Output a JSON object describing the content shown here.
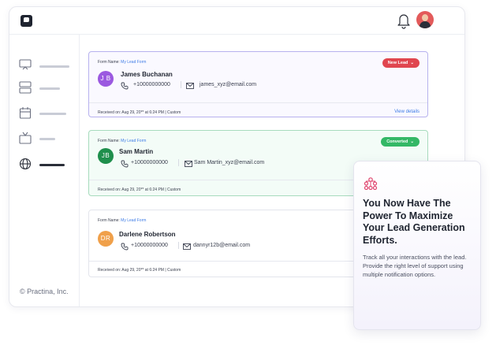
{
  "sidebar": {
    "copyright": "© Practina, Inc."
  },
  "leads": [
    {
      "form_name_label": "Form Name:",
      "form_name": "My Lead Form",
      "status": "New Lead",
      "status_color": "#e0464f",
      "initials": "J B",
      "avatar_color": "#9b59e0",
      "name": "James Buchanan",
      "phone": "+10000000000",
      "email": "james_xyz@email.com",
      "received": "Received on: Aug 29, 20** at 6:24 PM | Custom",
      "view_details": "View details"
    },
    {
      "form_name_label": "Form Name:",
      "form_name": "My Lead Form",
      "status": "Converted",
      "status_color": "#34b866",
      "initials": "JB",
      "avatar_color": "#1f8f4c",
      "name": "Sam Martin",
      "phone": "+10000000000",
      "email": "Sam Martin_xyz@email.com",
      "received": "Received on: Aug 29, 20** at 6:24 PM | Custom"
    },
    {
      "form_name_label": "Form Name:",
      "form_name": "My Lead Form",
      "initials": "DR",
      "avatar_color": "#f0a04a",
      "name": "Darlene Robertson",
      "phone": "+10000000000",
      "email": "dannyr12b@email.com",
      "received": "Received on: Aug 29, 20** at 6:24 PM | Custom"
    }
  ],
  "popup": {
    "title": "You Now Have The Power To Maximize Your Lead Generation Efforts.",
    "text": "Track all your interactions with the lead. Provide the right level of support using multiple notification options.",
    "icon": "network-icon",
    "icon_color": "#e0466e"
  }
}
